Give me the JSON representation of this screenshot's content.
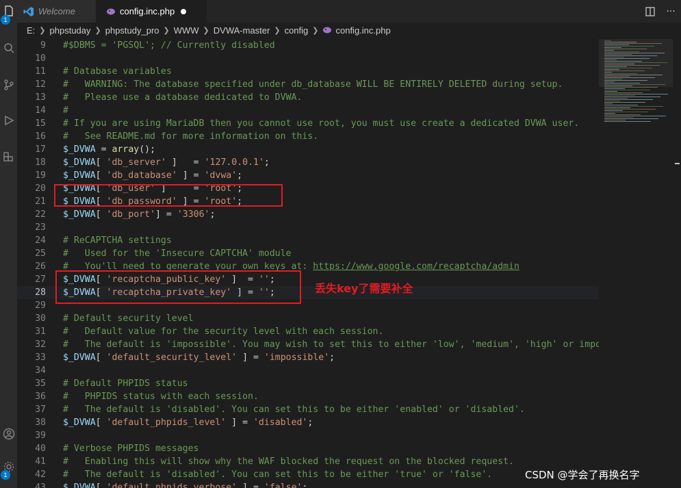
{
  "tabs": [
    {
      "label": "Welcome"
    },
    {
      "label": "config.inc.php"
    }
  ],
  "activity_bar": {
    "explorer_badge": "1",
    "settings_badge": "1"
  },
  "breadcrumb": [
    "E:",
    "phpstuday",
    "phpstudy_pro",
    "WWW",
    "DVWA-master",
    "config",
    "config.inc.php"
  ],
  "editor": {
    "lines": [
      {
        "n": "9",
        "text": "#$DBMS = 'PGSQL'; // Currently disabled"
      },
      {
        "n": "10",
        "text": ""
      },
      {
        "n": "11",
        "text": "# Database variables"
      },
      {
        "n": "12",
        "text": "#   WARNING: The database specified under db_database WILL BE ENTIRELY DELETED during setup."
      },
      {
        "n": "13",
        "text": "#   Please use a database dedicated to DVWA."
      },
      {
        "n": "14",
        "text": "#"
      },
      {
        "n": "15",
        "text": "# If you are using MariaDB then you cannot use root, you must use create a dedicated DVWA user."
      },
      {
        "n": "16",
        "text": "#   See README.md for more information on this."
      },
      {
        "n": "17",
        "text": "$_DVWA = array();"
      },
      {
        "n": "18",
        "text": "$_DVWA[ 'db_server' ]   = '127.0.0.1';"
      },
      {
        "n": "19",
        "text": "$_DVWA[ 'db_database' ] = 'dvwa';"
      },
      {
        "n": "20",
        "text": "$_DVWA[ 'db_user' ]     = 'root';"
      },
      {
        "n": "21",
        "text": "$_DVWA[ 'db_password' ] = 'root';"
      },
      {
        "n": "22",
        "text": "$_DVWA[ 'db_port'] = '3306';"
      },
      {
        "n": "23",
        "text": ""
      },
      {
        "n": "24",
        "text": "# ReCAPTCHA settings"
      },
      {
        "n": "25",
        "text": "#   Used for the 'Insecure CAPTCHA' module"
      },
      {
        "n": "26",
        "text": "#   You'll need to generate your own keys at: https://www.google.com/recaptcha/admin"
      },
      {
        "n": "27",
        "text": "$_DVWA[ 'recaptcha_public_key' ]  = '';"
      },
      {
        "n": "28",
        "text": "$_DVWA[ 'recaptcha_private_key' ] = '';"
      },
      {
        "n": "29",
        "text": ""
      },
      {
        "n": "30",
        "text": "# Default security level"
      },
      {
        "n": "31",
        "text": "#   Default value for the security level with each session."
      },
      {
        "n": "32",
        "text": "#   The default is 'impossible'. You may wish to set this to either 'low', 'medium', 'high' or impossi"
      },
      {
        "n": "33",
        "text": "$_DVWA[ 'default_security_level' ] = 'impossible';"
      },
      {
        "n": "34",
        "text": ""
      },
      {
        "n": "35",
        "text": "# Default PHPIDS status"
      },
      {
        "n": "36",
        "text": "#   PHPIDS status with each session."
      },
      {
        "n": "37",
        "text": "#   The default is 'disabled'. You can set this to be either 'enabled' or 'disabled'."
      },
      {
        "n": "38",
        "text": "$_DVWA[ 'default_phpids_level' ] = 'disabled';"
      },
      {
        "n": "39",
        "text": ""
      },
      {
        "n": "40",
        "text": "# Verbose PHPIDS messages"
      },
      {
        "n": "41",
        "text": "#   Enabling this will show why the WAF blocked the request on the blocked request."
      },
      {
        "n": "42",
        "text": "#   The default is 'disabled'. You can set this to be either 'true' or 'false'."
      },
      {
        "n": "43",
        "text": "$_DVWA[ 'default_phpids_verbose' ] = 'false';"
      }
    ],
    "current_line": "28"
  },
  "annotation": {
    "text": "丢失key了需要补全",
    "color": "#e31b23"
  },
  "watermark": "CSDN @学会了再换名字",
  "colors": {
    "comment": "#6a9955",
    "variable": "#9cdcfe",
    "string": "#ce9178",
    "function": "#dcdcaa",
    "highlight": "#e31b23"
  }
}
